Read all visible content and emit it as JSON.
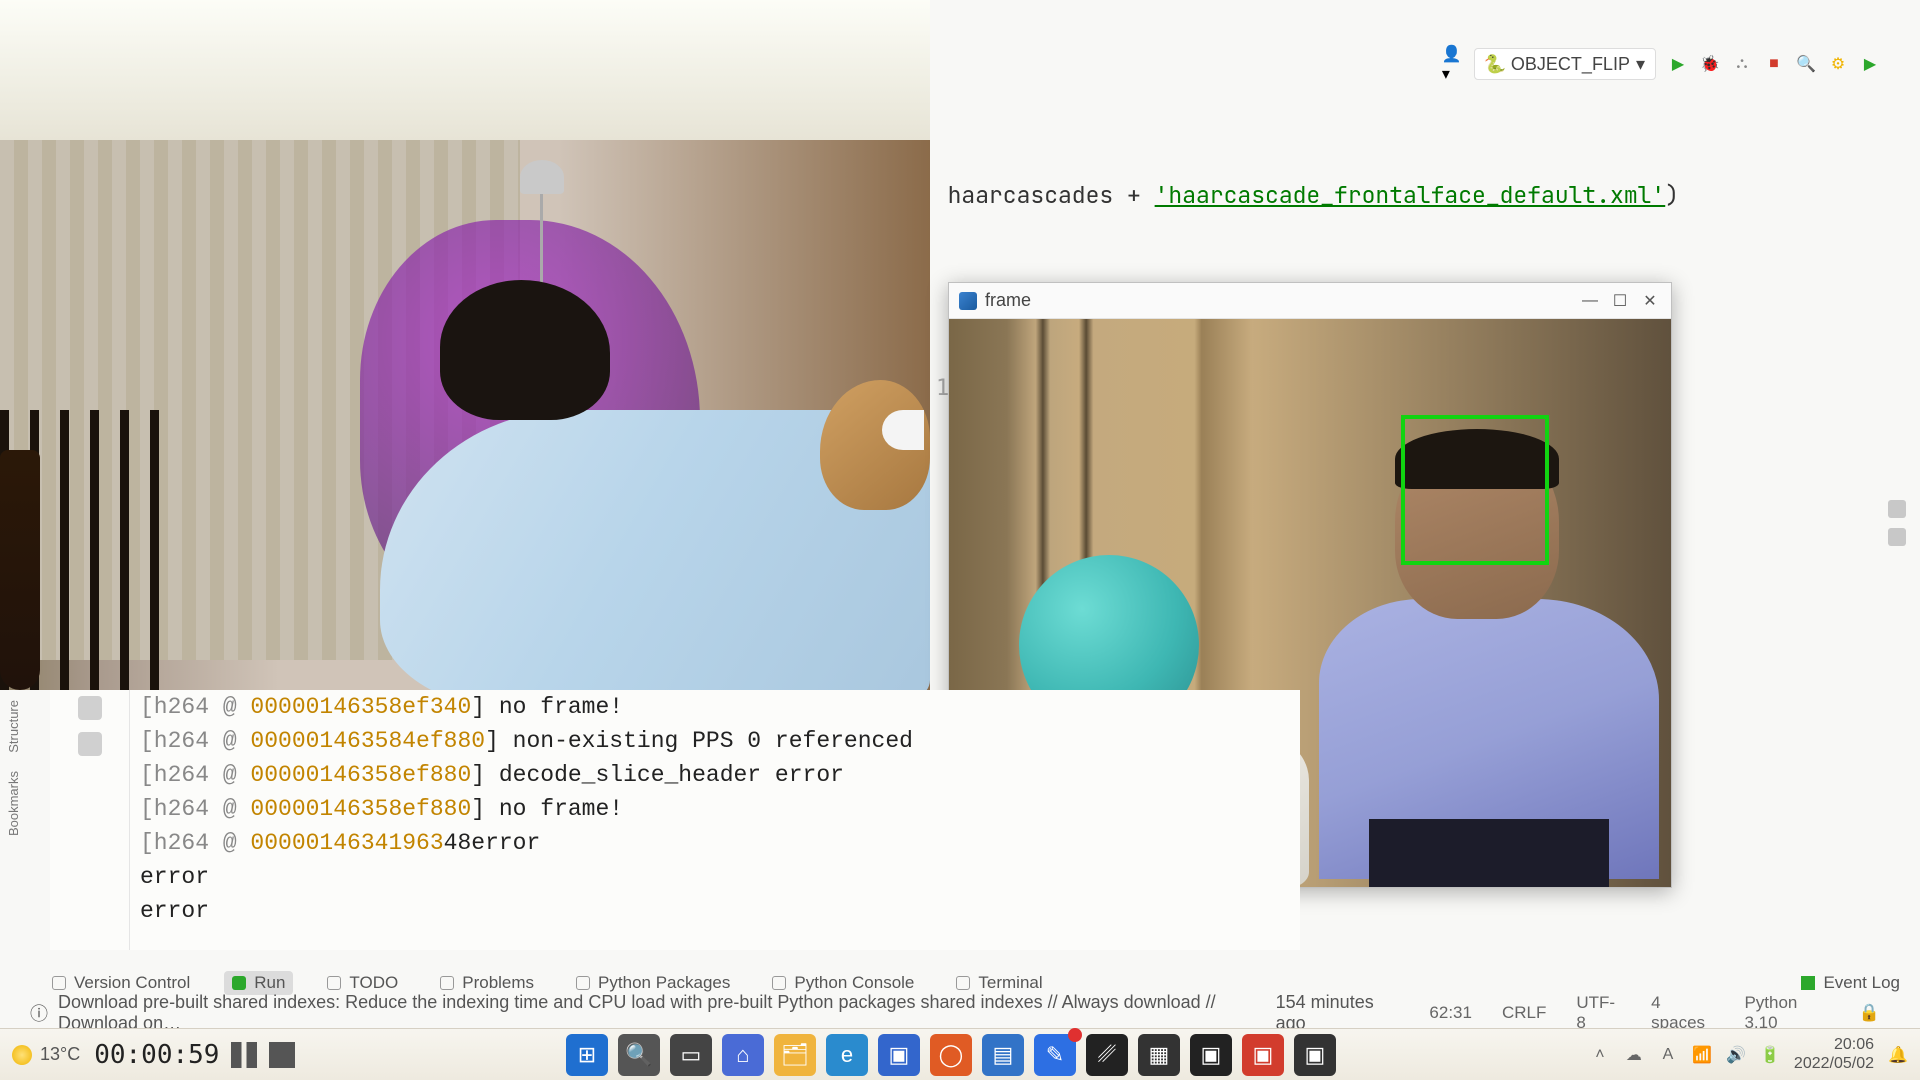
{
  "ide": {
    "run_config_label": "OBJECT_FLIP",
    "code_fragment": {
      "prefix": "haarcascades + ",
      "string_literal": "'haarcascade_frontalface_default.xml'",
      "suffix": ")"
    },
    "line_marker": "1"
  },
  "left_toolstrip": {
    "structure": "Structure",
    "bookmarks": "Bookmarks"
  },
  "cv_window": {
    "title": "frame"
  },
  "console": {
    "lines": [
      {
        "tag": "[h264 @ ",
        "addr": "00000146358ef340",
        "rest": "] no frame!"
      },
      {
        "tag": "[h264 @ ",
        "addr": "000001463584ef880",
        "rest": "] non-existing PPS 0 referenced"
      },
      {
        "tag": "[h264 @ ",
        "addr": "00000146358ef880",
        "rest": "] decode_slice_header error"
      },
      {
        "tag": "[h264 @ ",
        "addr": "00000146358ef880",
        "rest": "] no frame!"
      },
      {
        "tag": "[h264 @ ",
        "addr": "00000146341963",
        "rest": "48error"
      },
      {
        "tag": "",
        "addr": "",
        "rest": "error"
      },
      {
        "tag": "",
        "addr": "",
        "rest": "error"
      }
    ]
  },
  "bottom_tabs": {
    "version_control": "Version Control",
    "run": "Run",
    "todo": "TODO",
    "problems": "Problems",
    "python_packages": "Python Packages",
    "python_console": "Python Console",
    "terminal": "Terminal",
    "event_log": "Event Log"
  },
  "notification": {
    "text": "Download pre-built shared indexes: Reduce the indexing time and CPU load with pre-built Python packages shared indexes // Always download // Download on…",
    "age": "154 minutes ago"
  },
  "status_bar": {
    "caret": "62:31",
    "line_sep": "CRLF",
    "encoding": "UTF-8",
    "indent": "4 spaces",
    "interpreter": "Python 3.10"
  },
  "taskbar": {
    "weather_temp": "13°C",
    "rec_timer": "00:00:59",
    "clock_time": "20:06",
    "clock_date": "2022/05/02"
  }
}
